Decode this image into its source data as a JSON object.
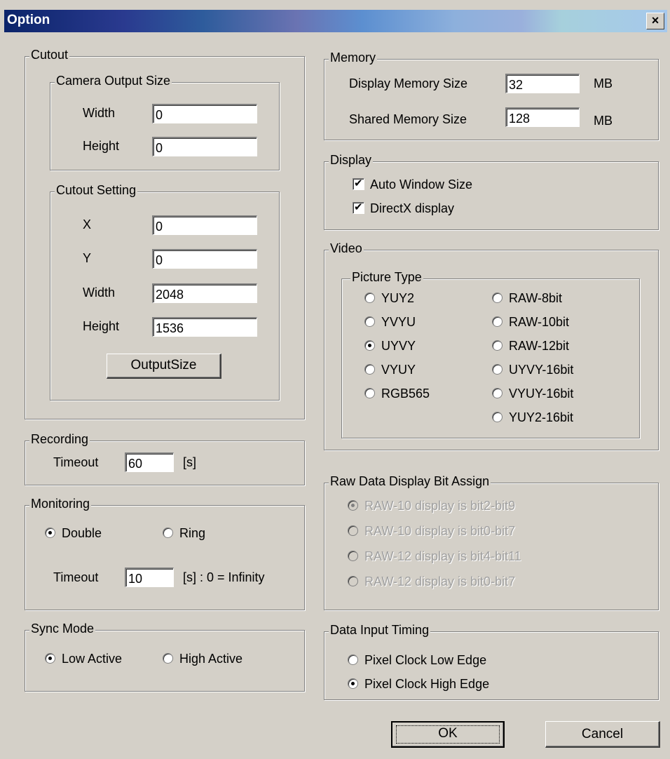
{
  "window": {
    "title": "Option",
    "close_label": "×"
  },
  "cutout": {
    "legend": "Cutout",
    "camera_output_size": {
      "legend": "Camera Output Size",
      "width_label": "Width",
      "width_value": "0",
      "height_label": "Height",
      "height_value": "0"
    },
    "cutout_setting": {
      "legend": "Cutout Setting",
      "x_label": "X",
      "x_value": "0",
      "y_label": "Y",
      "y_value": "0",
      "width_label": "Width",
      "width_value": "2048",
      "height_label": "Height",
      "height_value": "1536",
      "output_size_button": "OutputSize"
    }
  },
  "recording": {
    "legend": "Recording",
    "timeout_label": "Timeout",
    "timeout_value": "60",
    "unit": "[s]"
  },
  "monitoring": {
    "legend": "Monitoring",
    "double_label": "Double",
    "double_selected": true,
    "ring_label": "Ring",
    "ring_selected": false,
    "timeout_label": "Timeout",
    "timeout_value": "10",
    "unit": "[s] : 0 = Infinity"
  },
  "sync_mode": {
    "legend": "Sync Mode",
    "low_label": "Low Active",
    "low_selected": true,
    "high_label": "High Active",
    "high_selected": false
  },
  "memory": {
    "legend": "Memory",
    "display_label": "Display Memory Size",
    "display_value": "32",
    "display_unit": "MB",
    "shared_label": "Shared Memory Size",
    "shared_value": "128",
    "shared_unit": "MB"
  },
  "display": {
    "legend": "Display",
    "auto_window_label": "Auto Window Size",
    "auto_window_checked": true,
    "directx_label": "DirectX display",
    "directx_checked": true
  },
  "video": {
    "legend": "Video",
    "picture_type_legend": "Picture Type",
    "left_options": [
      "YUY2",
      "YVYU",
      "UYVY",
      "VYUY",
      "RGB565"
    ],
    "right_options": [
      "RAW-8bit",
      "RAW-10bit",
      "RAW-12bit",
      "UYVY-16bit",
      "VYUY-16bit",
      "YUY2-16bit"
    ],
    "selected": "UYVY"
  },
  "raw_bit_assign": {
    "legend": "Raw Data Display Bit Assign",
    "options": [
      "RAW-10 display is bit2-bit9",
      "RAW-10 display is bit0-bit7",
      "RAW-12 display is bit4-bit11",
      "RAW-12 display is bit0-bit7"
    ],
    "selected_index": 0,
    "enabled": false
  },
  "data_input_timing": {
    "legend": "Data Input Timing",
    "low_edge_label": "Pixel Clock Low Edge",
    "low_edge_selected": false,
    "high_edge_label": "Pixel Clock High Edge",
    "high_edge_selected": true
  },
  "buttons": {
    "ok": "OK",
    "cancel": "Cancel"
  }
}
